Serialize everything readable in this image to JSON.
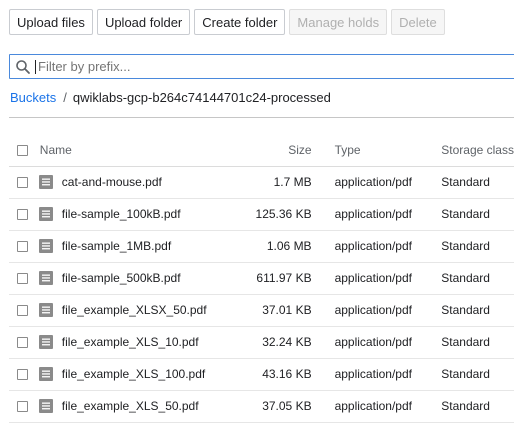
{
  "toolbar": {
    "upload_files": "Upload files",
    "upload_folder": "Upload folder",
    "create_folder": "Create folder",
    "manage_holds": "Manage holds",
    "delete": "Delete"
  },
  "search": {
    "placeholder": "Filter by prefix...",
    "icon": "search-icon"
  },
  "breadcrumb": {
    "root": "Buckets",
    "separator": "/",
    "current": "qwiklabs-gcp-b264c74144701c24-processed"
  },
  "table": {
    "columns": {
      "name": "Name",
      "size": "Size",
      "type": "Type",
      "storage_class": "Storage class"
    },
    "rows": [
      {
        "name": "cat-and-mouse.pdf",
        "size": "1.7 MB",
        "type": "application/pdf",
        "storage_class": "Standard"
      },
      {
        "name": "file-sample_100kB.pdf",
        "size": "125.36 KB",
        "type": "application/pdf",
        "storage_class": "Standard"
      },
      {
        "name": "file-sample_1MB.pdf",
        "size": "1.06 MB",
        "type": "application/pdf",
        "storage_class": "Standard"
      },
      {
        "name": "file-sample_500kB.pdf",
        "size": "611.97 KB",
        "type": "application/pdf",
        "storage_class": "Standard"
      },
      {
        "name": "file_example_XLSX_50.pdf",
        "size": "37.01 KB",
        "type": "application/pdf",
        "storage_class": "Standard"
      },
      {
        "name": "file_example_XLS_10.pdf",
        "size": "32.24 KB",
        "type": "application/pdf",
        "storage_class": "Standard"
      },
      {
        "name": "file_example_XLS_100.pdf",
        "size": "43.16 KB",
        "type": "application/pdf",
        "storage_class": "Standard"
      },
      {
        "name": "file_example_XLS_50.pdf",
        "size": "37.05 KB",
        "type": "application/pdf",
        "storage_class": "Standard"
      }
    ]
  },
  "colors": {
    "link": "#1a73e8",
    "focus_border": "#4a89dc",
    "icon_gray": "#8a8a8a"
  }
}
